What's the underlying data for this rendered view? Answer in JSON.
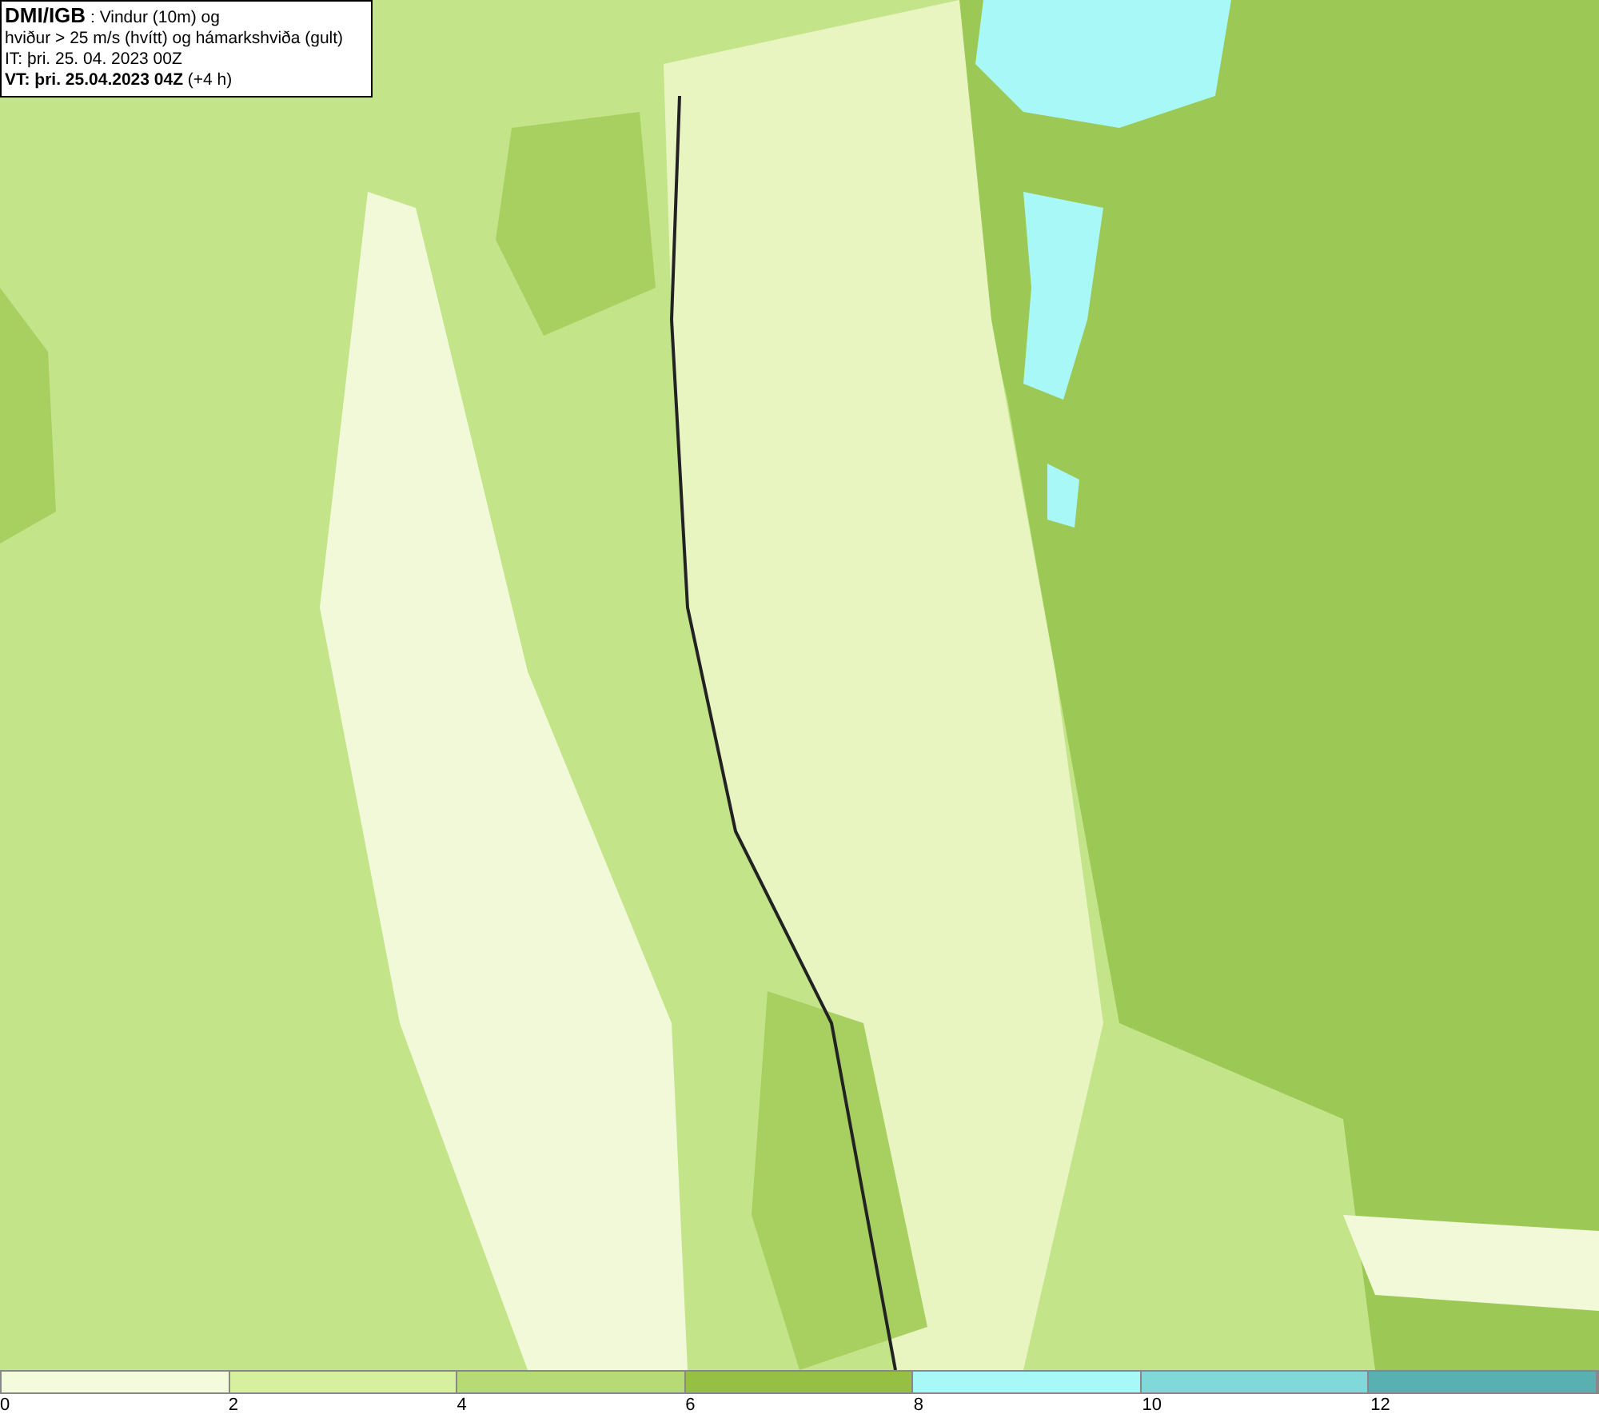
{
  "legend": {
    "lines": [
      "**DMI/IGB** : Vindur (10m) og",
      "hviður > 25 m/s (hvítt) og hámarkshviða (gult)",
      "IT: þri. 25. 04. 2023 00Z",
      "**VT: þri. 25.04.2023 04Z** (+4 h)"
    ]
  },
  "colorbar": [
    {
      "label": "0",
      "color": "#f4fadc"
    },
    {
      "label": "2",
      "color": "#d6f0a0"
    },
    {
      "label": "4",
      "color": "#b6da74"
    },
    {
      "label": "6",
      "color": "#96c044"
    },
    {
      "label": "8",
      "color": "#a8f8f8"
    },
    {
      "label": "10",
      "color": "#80d8d8"
    },
    {
      "label": "12",
      "color": "#58b0b0"
    }
  ]
}
